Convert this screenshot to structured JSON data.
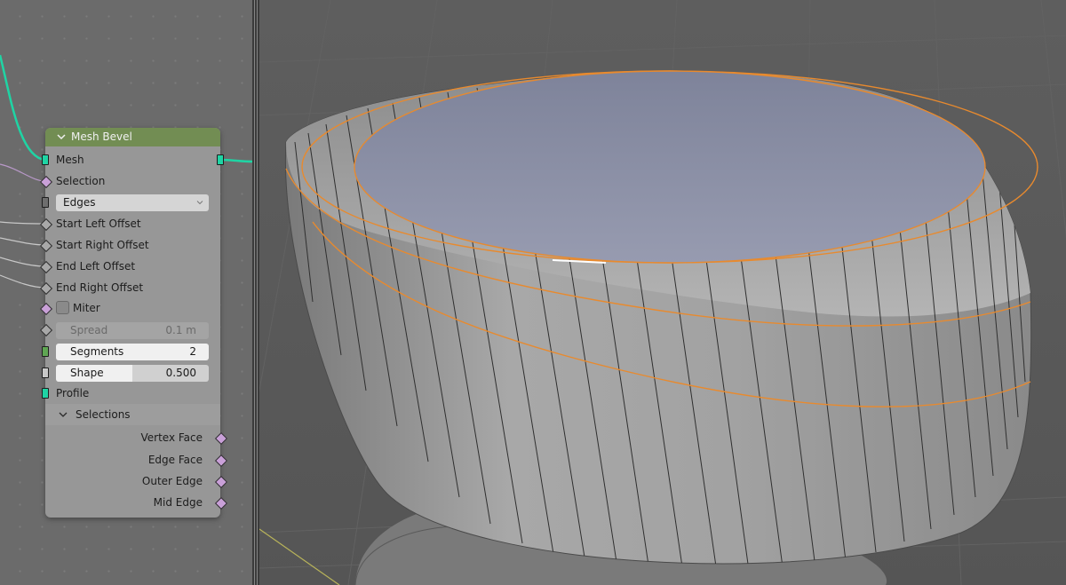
{
  "node": {
    "title": "Mesh Bevel",
    "inputs": {
      "mesh": "Mesh",
      "selection": "Selection",
      "mode_value": "Edges",
      "start_left_offset": "Start Left Offset",
      "start_right_offset": "Start Right Offset",
      "end_left_offset": "End Left Offset",
      "end_right_offset": "End Right Offset",
      "miter": "Miter",
      "spread": {
        "label": "Spread",
        "value": "0.1 m"
      },
      "segments": {
        "label": "Segments",
        "value": "2"
      },
      "shape": {
        "label": "Shape",
        "value": "0.500",
        "fraction": 0.5
      },
      "profile": "Profile"
    },
    "selections_panel": {
      "label": "Selections",
      "outputs": [
        "Vertex Face",
        "Edge Face",
        "Outer Edge",
        "Mid Edge"
      ]
    }
  },
  "colors": {
    "node_header": "#728d53",
    "geometry_socket": "#1fd4a4",
    "field_socket": "#c9a0d8",
    "selection_outline": "#e88a2e",
    "top_face": "#8e92a6"
  },
  "icons": {
    "header_collapse": "chevron-down-icon",
    "dropdown": "chevron-down-icon",
    "panel_collapse": "chevron-down-icon"
  }
}
